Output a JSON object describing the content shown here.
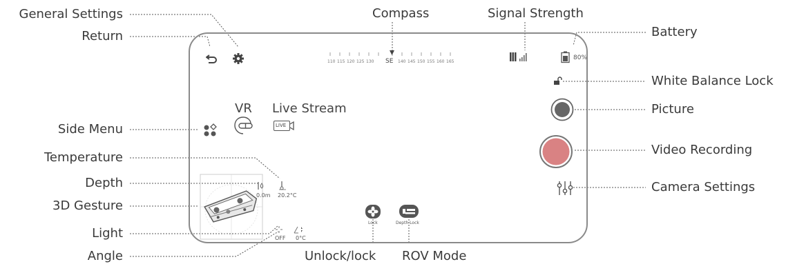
{
  "callouts": {
    "general_settings": "General Settings",
    "return": "Return",
    "side_menu": "Side Menu",
    "temperature": "Temperature",
    "depth": "Depth",
    "gesture_3d": "3D Gesture",
    "light": "Light",
    "angle": "Angle",
    "compass": "Compass",
    "signal_strength": "Signal Strength",
    "battery": "Battery",
    "white_balance_lock": "White Balance Lock",
    "picture": "Picture",
    "video_recording": "Video Recording",
    "camera_settings": "Camera Settings",
    "unlock_lock": "Unlock/lock",
    "rov_mode": "ROV Mode"
  },
  "screen": {
    "compass_ticks": [
      "110",
      "115",
      "120",
      "125",
      "130",
      "SE",
      "140",
      "145",
      "150",
      "155",
      "160",
      "165"
    ],
    "battery_text": "80%",
    "vr_label": "VR",
    "live_stream_label": "Live Stream",
    "live_badge": "LIVE",
    "depth_value": "0.0m",
    "temperature_value": "20.2°C",
    "light_value": "OFF",
    "angle_value": "0°C",
    "lock_label": "Lock",
    "depth_lock_label": "Depth Lock"
  },
  "colors": {
    "frame": "#8a8a8a",
    "icon": "#555555",
    "record_fill": "#d98283",
    "picture_fill": "#666666",
    "leader": "#555555"
  },
  "icons": [
    "return-icon",
    "gear-icon",
    "compass-needle-icon",
    "signal-icon",
    "battery-icon",
    "padlock-icon",
    "vr-headset-icon",
    "live-stream-icon",
    "side-menu-icon",
    "rov-3d-model-icon",
    "temperature-icon",
    "depth-icon",
    "light-icon",
    "angle-icon",
    "camera-settings-icon",
    "unlock-icon",
    "depth-lock-icon"
  ]
}
